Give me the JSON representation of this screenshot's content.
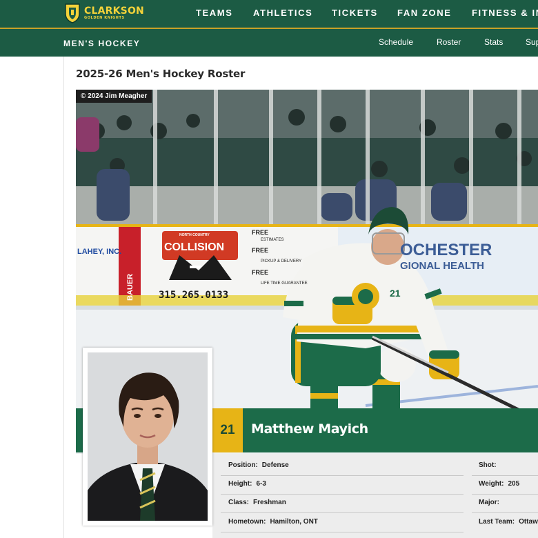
{
  "site": {
    "logo_text": "CLARKSON",
    "logo_subtext": "GOLDEN KNIGHTS"
  },
  "topnav": {
    "items": [
      "TEAMS",
      "ATHLETICS",
      "TICKETS",
      "FAN ZONE",
      "FITNESS & IN"
    ]
  },
  "subnav": {
    "title": "MEN'S HOCKEY",
    "links": [
      "Schedule",
      "Roster",
      "Stats",
      "Sup"
    ]
  },
  "page": {
    "title": "2025-26 Men's Hockey Roster"
  },
  "hero": {
    "photo_credit": "© 2024 Jim Meagher",
    "board_phone": "315.265.0133",
    "board_brand": "COLLISION",
    "board_brand_top": "NORTH COUNTRY",
    "board_left": "LAHEY, INC.",
    "board_right_1": "OCHESTER",
    "board_right_2": "GIONAL HEALTH",
    "board_vert": "BAUER",
    "board_free_1": "FREE",
    "board_free_1_sub": "ESTIMATES",
    "board_free_2": "FREE",
    "board_free_2_sub": "PICKUP & DELIVERY",
    "board_free_3": "FREE",
    "board_free_3_sub": "LIFE TIME GUARANTEE",
    "jersey_sleeve": "21"
  },
  "player": {
    "number": "21",
    "name": "Matthew Mayich",
    "details": {
      "position_label": "Position:",
      "position": "Defense",
      "height_label": "Height:",
      "height": "6-3",
      "class_label": "Class:",
      "class": "Freshman",
      "hometown_label": "Hometown:",
      "hometown": "Hamilton, ONT",
      "shot_label": "Shot:",
      "shot": "",
      "weight_label": "Weight:",
      "weight": "205",
      "major_label": "Major:",
      "major": "",
      "lastteam_label": "Last Team:",
      "lastteam": "Ottawa"
    }
  },
  "colors": {
    "brand_green": "#1c5b44",
    "name_bar_green": "#1c6b49",
    "gold": "#e7b416"
  }
}
